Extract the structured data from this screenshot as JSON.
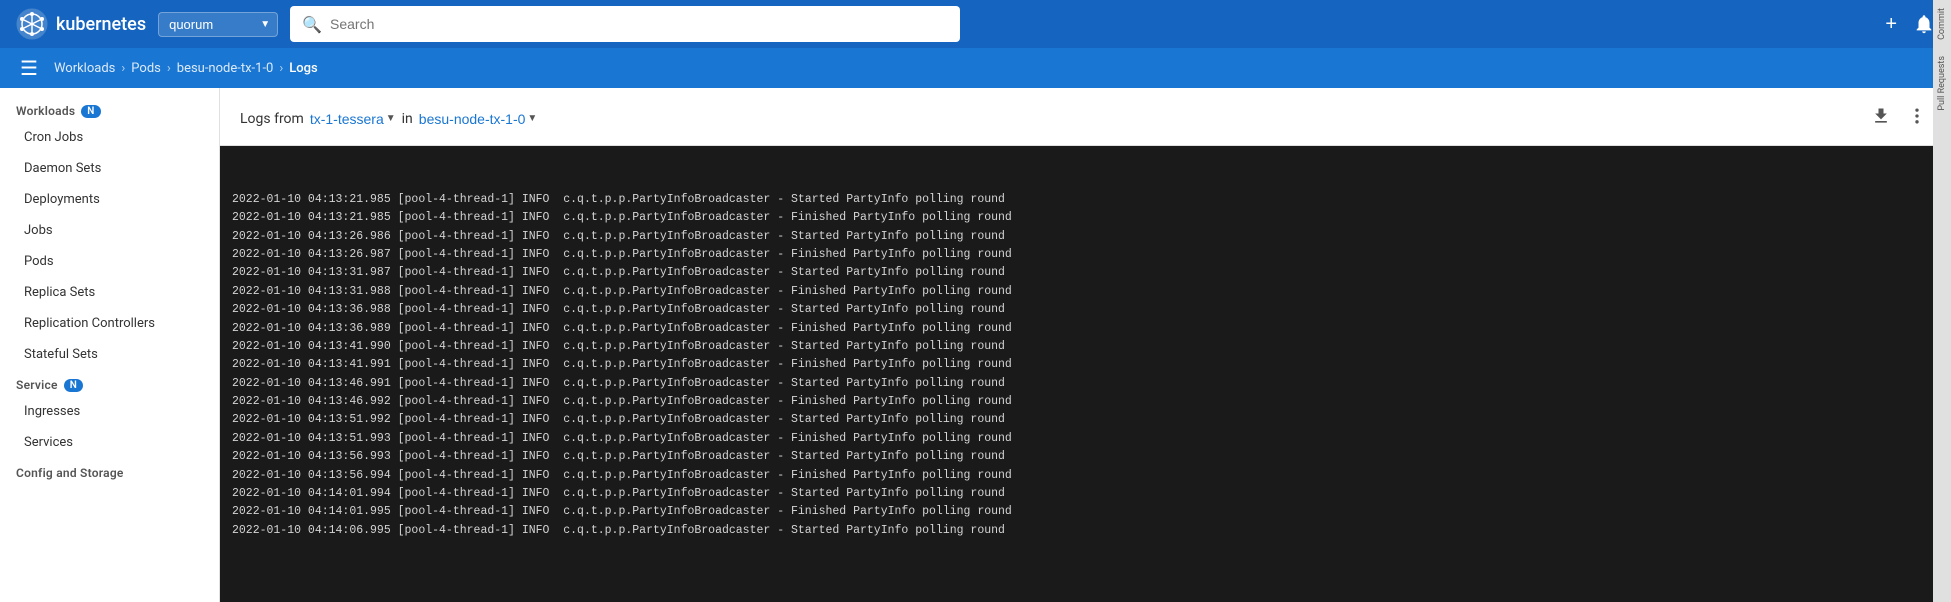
{
  "app": {
    "name": "kubernetes",
    "logo_alt": "Kubernetes logo"
  },
  "cluster": {
    "name": "quorum",
    "options": [
      "quorum"
    ]
  },
  "search": {
    "placeholder": "Search"
  },
  "nav_actions": {
    "add_label": "+",
    "notification_label": "🔔"
  },
  "right_panel": {
    "items": [
      "Commit",
      "Pull Requests"
    ]
  },
  "breadcrumb": {
    "items": [
      {
        "label": "Workloads",
        "link": true
      },
      {
        "label": "Pods",
        "link": true
      },
      {
        "label": "besu-node-tx-1-0",
        "link": true
      },
      {
        "label": "Logs",
        "link": false
      }
    ]
  },
  "sidebar": {
    "sections": [
      {
        "id": "workloads",
        "label": "Workloads",
        "badge": "N",
        "items": [
          {
            "id": "cron-jobs",
            "label": "Cron Jobs"
          },
          {
            "id": "daemon-sets",
            "label": "Daemon Sets"
          },
          {
            "id": "deployments",
            "label": "Deployments"
          },
          {
            "id": "jobs",
            "label": "Jobs"
          },
          {
            "id": "pods",
            "label": "Pods"
          },
          {
            "id": "replica-sets",
            "label": "Replica Sets"
          },
          {
            "id": "replication-controllers",
            "label": "Replication Controllers"
          },
          {
            "id": "stateful-sets",
            "label": "Stateful Sets"
          }
        ]
      },
      {
        "id": "service",
        "label": "Service",
        "badge": "N",
        "items": [
          {
            "id": "ingresses",
            "label": "Ingresses"
          },
          {
            "id": "services",
            "label": "Services"
          }
        ]
      },
      {
        "id": "config-storage",
        "label": "Config and Storage",
        "badge": null,
        "items": []
      }
    ]
  },
  "logs_panel": {
    "from_label": "Logs from",
    "container_selector": "tx-1-tessera",
    "in_label": "in",
    "pod_selector": "besu-node-tx-1-0",
    "lines": [
      "2022-01-10 04:13:21.985 [pool-4-thread-1] INFO  c.q.t.p.p.PartyInfoBroadcaster - Started PartyInfo polling round",
      "2022-01-10 04:13:21.985 [pool-4-thread-1] INFO  c.q.t.p.p.PartyInfoBroadcaster - Finished PartyInfo polling round",
      "2022-01-10 04:13:26.986 [pool-4-thread-1] INFO  c.q.t.p.p.PartyInfoBroadcaster - Started PartyInfo polling round",
      "2022-01-10 04:13:26.987 [pool-4-thread-1] INFO  c.q.t.p.p.PartyInfoBroadcaster - Finished PartyInfo polling round",
      "2022-01-10 04:13:31.987 [pool-4-thread-1] INFO  c.q.t.p.p.PartyInfoBroadcaster - Started PartyInfo polling round",
      "2022-01-10 04:13:31.988 [pool-4-thread-1] INFO  c.q.t.p.p.PartyInfoBroadcaster - Finished PartyInfo polling round",
      "2022-01-10 04:13:36.988 [pool-4-thread-1] INFO  c.q.t.p.p.PartyInfoBroadcaster - Started PartyInfo polling round",
      "2022-01-10 04:13:36.989 [pool-4-thread-1] INFO  c.q.t.p.p.PartyInfoBroadcaster - Finished PartyInfo polling round",
      "2022-01-10 04:13:41.990 [pool-4-thread-1] INFO  c.q.t.p.p.PartyInfoBroadcaster - Started PartyInfo polling round",
      "2022-01-10 04:13:41.991 [pool-4-thread-1] INFO  c.q.t.p.p.PartyInfoBroadcaster - Finished PartyInfo polling round",
      "2022-01-10 04:13:46.991 [pool-4-thread-1] INFO  c.q.t.p.p.PartyInfoBroadcaster - Started PartyInfo polling round",
      "2022-01-10 04:13:46.992 [pool-4-thread-1] INFO  c.q.t.p.p.PartyInfoBroadcaster - Finished PartyInfo polling round",
      "2022-01-10 04:13:51.992 [pool-4-thread-1] INFO  c.q.t.p.p.PartyInfoBroadcaster - Started PartyInfo polling round",
      "2022-01-10 04:13:51.993 [pool-4-thread-1] INFO  c.q.t.p.p.PartyInfoBroadcaster - Finished PartyInfo polling round",
      "2022-01-10 04:13:56.993 [pool-4-thread-1] INFO  c.q.t.p.p.PartyInfoBroadcaster - Started PartyInfo polling round",
      "2022-01-10 04:13:56.994 [pool-4-thread-1] INFO  c.q.t.p.p.PartyInfoBroadcaster - Finished PartyInfo polling round",
      "2022-01-10 04:14:01.994 [pool-4-thread-1] INFO  c.q.t.p.p.PartyInfoBroadcaster - Started PartyInfo polling round",
      "2022-01-10 04:14:01.995 [pool-4-thread-1] INFO  c.q.t.p.p.PartyInfoBroadcaster - Finished PartyInfo polling round",
      "2022-01-10 04:14:06.995 [pool-4-thread-1] INFO  c.q.t.p.p.PartyInfoBroadcaster - Started PartyInfo polling round"
    ]
  }
}
